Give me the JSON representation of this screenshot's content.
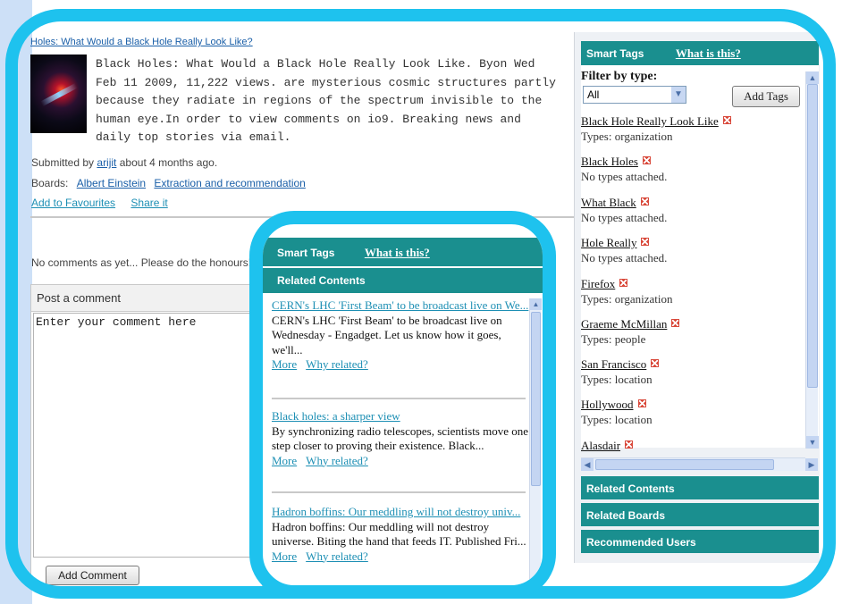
{
  "post": {
    "title": "Holes: What Would a Black Hole Really Look Like?",
    "body": "Black Holes: What Would a Black Hole Really Look Like. Byon Wed Feb 11 2009, 11,222 views. are mysterious cosmic structures partly because they radiate in regions of the spectrum invisible to the human eye.In order to view comments on io9. Breaking news and daily top stories via email.",
    "submitted_prefix": "Submitted by",
    "submitted_user": "arijit",
    "submitted_suffix": "about 4 months ago.",
    "boards_label": "Boards:",
    "boards": [
      "Albert Einstein",
      "Extraction and recommendation"
    ],
    "add_to_favourites": "Add to Favourites",
    "share_it": "Share it"
  },
  "comments": {
    "empty_text": "No comments as yet... Please do the honours!",
    "post_header": "Post a comment",
    "input_value": "Enter your comment here",
    "add_button": "Add Comment"
  },
  "sidebar": {
    "smart_tags_label": "Smart Tags",
    "what_is_this": "What is this?",
    "filter_label": "Filter by type:",
    "filter_value": "All",
    "add_tags_button": "Add Tags",
    "tags": [
      {
        "name": "Black Hole Really Look Like",
        "type": "Types: organization"
      },
      {
        "name": "Black Holes",
        "type": "No types attached."
      },
      {
        "name": "What Black",
        "type": "No types attached."
      },
      {
        "name": "Hole Really",
        "type": "No types attached."
      },
      {
        "name": "Firefox",
        "type": "Types: organization"
      },
      {
        "name": "Graeme McMillan",
        "type": "Types: people"
      },
      {
        "name": "San Francisco",
        "type": "Types: location"
      },
      {
        "name": "Hollywood",
        "type": "Types: location"
      },
      {
        "name": "Alasdair",
        "type": ""
      }
    ],
    "sections": [
      "Related Contents",
      "Related Boards",
      "Recommended Users"
    ]
  },
  "popup": {
    "smart_tags_label": "Smart Tags",
    "what_is_this": "What is this?",
    "related_contents": "Related Contents",
    "more_label": "More",
    "why_label": "Why related?",
    "items": [
      {
        "title": "CERN's LHC 'First Beam' to be broadcast live on We...",
        "snippet": "CERN's LHC 'First Beam' to be broadcast live on Wednesday - Engadget. Let us know how it goes, we'll..."
      },
      {
        "title": "Black holes: a sharper view",
        "snippet": "By synchronizing radio telescopes, scientists move one step closer to proving their existence. Black..."
      },
      {
        "title": "Hadron boffins: Our meddling will not destroy univ...",
        "snippet": "Hadron boffins: Our meddling will not destroy universe. Biting the hand that feeds IT. Published Fri..."
      }
    ]
  },
  "colors": {
    "teal": "#1a8f8f",
    "frame": "#1ec2ee",
    "strip": "#cde0f7"
  }
}
